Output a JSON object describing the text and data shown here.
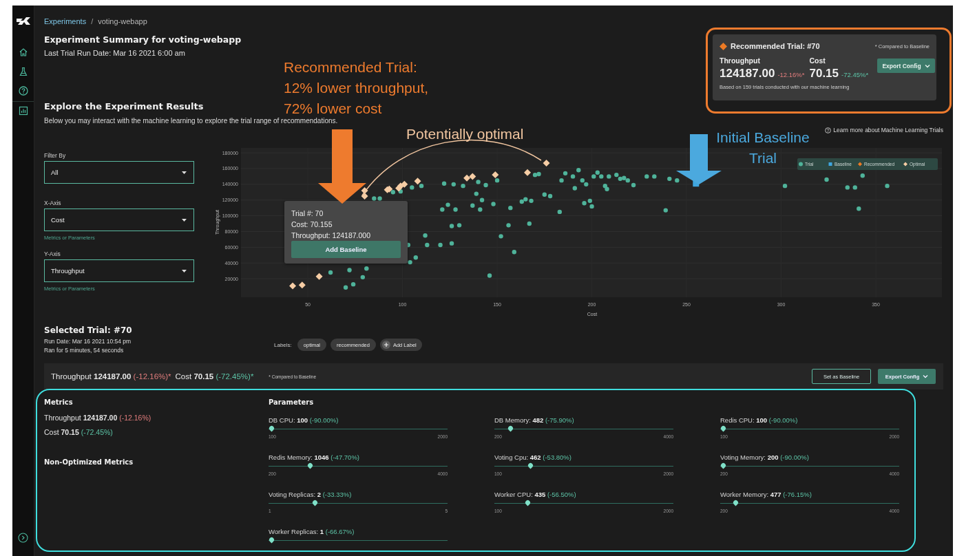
{
  "breadcrumb": {
    "items": [
      {
        "label": "Experiments",
        "kind": "link"
      },
      {
        "label": "voting-webapp",
        "kind": "current"
      }
    ],
    "separator": "/"
  },
  "summary": {
    "title": "Experiment Summary for voting-webapp",
    "last_run": "Last Trial Run Date: Mar 16 2021 6:00 am"
  },
  "recommended_card": {
    "title": "Recommended Trial: #70",
    "note": "* Compared to Baseline",
    "metrics": [
      {
        "label": "Throughput",
        "value": "124187.00",
        "change": "-12.16%*",
        "color": "#e27d7d"
      },
      {
        "label": "Cost",
        "value": "70.15",
        "change": "-72.45%*",
        "color": "#5cc3a6"
      }
    ],
    "button": "Export Config",
    "footnote": "Based on 159 trials conducted with our machine learning"
  },
  "explore": {
    "title": "Explore the Experiment Results",
    "description": "Below you may interact with the machine learning to explore the trial range of recommendations.",
    "learn_more": "Learn more about Machine Learning Trials"
  },
  "filters": [
    {
      "label": "Filter By",
      "value": "All"
    },
    {
      "label": "X-Axis",
      "value": "Cost",
      "hint": "Metrics or Parameters"
    },
    {
      "label": "Y-Axis",
      "value": "Throughput",
      "hint": "Metrics or Parameters"
    }
  ],
  "chart": {
    "chart_data": {
      "type": "scatter",
      "xlabel": "Cost",
      "ylabel": "Throughput",
      "xlim": [
        14.7,
        384.9
      ],
      "ylim": [
        -3500,
        186200
      ],
      "grid": true,
      "legend": true,
      "xticks": [
        50,
        100,
        150,
        200,
        250,
        300,
        350
      ],
      "yticks": [
        20000,
        40000,
        60000,
        80000,
        100000,
        120000,
        140000,
        160000,
        180000
      ],
      "series": [
        {
          "name": "Trial",
          "color": "#4fb39a",
          "x": [
            62,
            70,
            72,
            74,
            79,
            81,
            85,
            88,
            95,
            99,
            103,
            104,
            105,
            107,
            110,
            112,
            113,
            120,
            121,
            122,
            124,
            126,
            126,
            127,
            128,
            130,
            132,
            137,
            139,
            140,
            141,
            142,
            144,
            146,
            148,
            150,
            152,
            156,
            157,
            159,
            163,
            165,
            167,
            168,
            170,
            172,
            175,
            178,
            183,
            184,
            186,
            190,
            191,
            193,
            195,
            196,
            197,
            199,
            200,
            201,
            203,
            205,
            207,
            208,
            209,
            213,
            215,
            217,
            219,
            222,
            229,
            233,
            239,
            241,
            245,
            302,
            324,
            335,
            339,
            341,
            343,
            356
          ],
          "values": [
            28000,
            9000,
            31000,
            13000,
            22000,
            33000,
            122000,
            122000,
            130000,
            131000,
            63000,
            41000,
            136000,
            47000,
            138000,
            75000,
            63000,
            63000,
            108000,
            141000,
            114000,
            87000,
            65000,
            140000,
            108000,
            88000,
            138000,
            113000,
            128000,
            143000,
            108000,
            120000,
            139000,
            24000,
            115000,
            145000,
            74000,
            88000,
            110000,
            54000,
            118000,
            121000,
            90000,
            119000,
            152000,
            153000,
            127000,
            125000,
            105000,
            145000,
            154000,
            150000,
            135000,
            158000,
            145000,
            116000,
            140000,
            119000,
            112000,
            150000,
            155000,
            150000,
            138000,
            134000,
            150000,
            152000,
            147000,
            148000,
            145000,
            139000,
            150000,
            150000,
            107000,
            147000,
            145000,
            138000,
            146000,
            136000,
            136000,
            109000,
            151000,
            138000
          ]
        },
        {
          "name": "Baseline",
          "color": "#3fa6df",
          "x": [
            255
          ],
          "values": [
            141000
          ]
        },
        {
          "name": "Recommended",
          "color": "#ec7a24"
        },
        {
          "name": "Optimal",
          "color": "#f6cda5",
          "x": [
            42,
            47,
            56,
            80,
            80,
            92,
            93,
            98,
            99,
            101,
            108,
            134,
            137,
            149,
            166,
            176
          ],
          "values": [
            11000,
            12000,
            23000,
            125000,
            132000,
            133000,
            134000,
            135000,
            138000,
            140000,
            144000,
            148000,
            150000,
            152000,
            155000,
            167000
          ]
        }
      ]
    },
    "tooltip": {
      "lines": [
        "Trial #: 70",
        "Cost: 70.155",
        "Throughput: 124187.000"
      ],
      "button": "Add Baseline"
    }
  },
  "selected_trial": {
    "title": "Selected Trial: #70",
    "run_date": "Run Date: Mar 16 2021 10:54 pm",
    "duration": "Ran for 5 minutes, 54 seconds",
    "labels_caption": "Labels:",
    "labels": [
      "optimal",
      "recommended"
    ],
    "add_label": "Add Label"
  },
  "comparison_bar": {
    "metrics": [
      {
        "label": "Throughput",
        "value": "124187.00",
        "change": "(-12.16%)*",
        "color": "#e27d7d"
      },
      {
        "label": "Cost",
        "value": "70.15",
        "change": "(-72.45%)*",
        "color": "#5cc3a6"
      }
    ],
    "note": "* Compared to Baseline",
    "buttons": [
      {
        "label": "Set as Baseline",
        "kind": "outline"
      },
      {
        "label": "Export Config",
        "kind": "menu"
      }
    ]
  },
  "metrics": {
    "title": "Metrics",
    "items": [
      {
        "label": "Throughput",
        "value": "124187.00",
        "change": "(-12.16%)",
        "color": "#e27d7d"
      },
      {
        "label": "Cost",
        "value": "70.15",
        "change": "(-72.45%)",
        "color": "#5cc3a6"
      }
    ],
    "non_optimized_title": "Non-Optimized Metrics"
  },
  "parameters": {
    "title": "Parameters",
    "items": [
      {
        "name": "DB CPU:",
        "value": "100",
        "change": "(-90.00%)",
        "min": "100",
        "max": "2000",
        "level": 0
      },
      {
        "name": "DB Memory:",
        "value": "482",
        "change": "(-75.90%)",
        "min": "200",
        "max": "4000",
        "level": 0.074
      },
      {
        "name": "Redis CPU:",
        "value": "100",
        "change": "(-90.00%)",
        "min": "100",
        "max": "2000",
        "level": 0
      },
      {
        "name": "Redis Memory:",
        "value": "1046",
        "change": "(-47.70%)",
        "min": "200",
        "max": "4000",
        "level": 0.223
      },
      {
        "name": "Voting Cpu:",
        "value": "462",
        "change": "(-53.80%)",
        "min": "100",
        "max": "2000",
        "level": 0.19
      },
      {
        "name": "Voting Memory:",
        "value": "200",
        "change": "(-90.00%)",
        "min": "200",
        "max": "4000",
        "level": 0
      },
      {
        "name": "Voting Replicas:",
        "value": "2",
        "change": "(-33.33%)",
        "min": "1",
        "max": "5",
        "level": 0.25
      },
      {
        "name": "Worker CPU:",
        "value": "435",
        "change": "(-56.50%)",
        "min": "100",
        "max": "2000",
        "level": 0.176
      },
      {
        "name": "Worker Memory:",
        "value": "477",
        "change": "(-76.15%)",
        "min": "200",
        "max": "4000",
        "level": 0.073
      },
      {
        "name": "Worker Replicas:",
        "value": "1",
        "change": "(-66.67%)",
        "level": 0
      }
    ]
  },
  "annotations": [
    {
      "kind": "text",
      "lines": [
        "Recommended Trial:",
        "12% lower throughput,",
        "72% lower cost"
      ],
      "color": "#ee7b2e"
    },
    {
      "kind": "arrow",
      "color": "#ee7b2e"
    },
    {
      "kind": "arc",
      "color": "#f2c6a0"
    },
    {
      "kind": "text",
      "lines": [
        "Potentially optimal"
      ],
      "color": "#f2c6a0"
    },
    {
      "kind": "arrow",
      "color": "#4ba9de"
    },
    {
      "kind": "text",
      "lines": [
        "Initial Baseline",
        "Trial"
      ],
      "color": "#4ba9de"
    },
    {
      "kind": "outline",
      "color": "#ee7b2e"
    },
    {
      "kind": "outline",
      "color": "#3fdede"
    }
  ]
}
